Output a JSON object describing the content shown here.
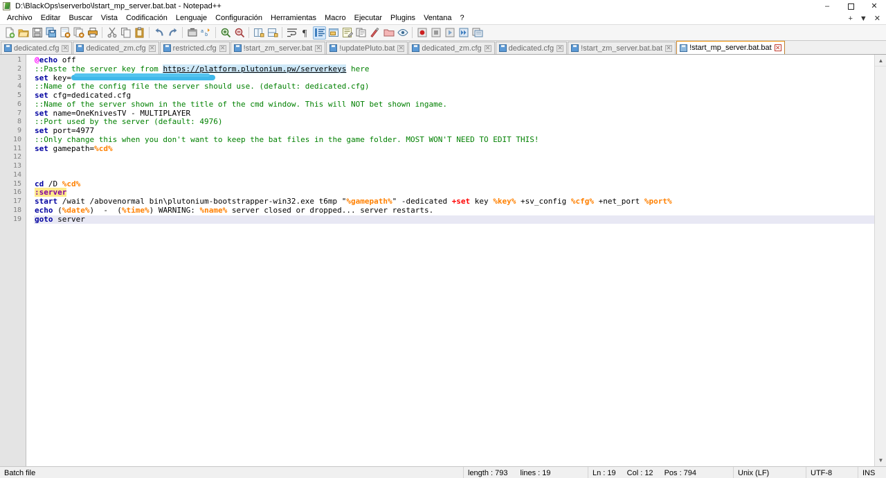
{
  "window": {
    "title": "D:\\BlackOps\\serverbo\\lstart_mp_server.bat.bat - Notepad++",
    "icon": "notepad-plus-plus-icon",
    "controls": {
      "minimize": "–",
      "maximize": "❐",
      "close": "✕"
    }
  },
  "menubar": {
    "items": [
      "Archivo",
      "Editar",
      "Buscar",
      "Vista",
      "Codificación",
      "Lenguaje",
      "Configuración",
      "Herramientas",
      "Macro",
      "Ejecutar",
      "Plugins",
      "Ventana",
      "?"
    ],
    "right": {
      "plus": "+",
      "chevron": "▼",
      "close": "✕"
    }
  },
  "toolbar": {
    "items": [
      "new-file-icon",
      "open-file-icon",
      "save-icon",
      "save-all-icon",
      "close-file-icon",
      "close-all-icon",
      "print-icon",
      "cut-icon",
      "copy-icon",
      "paste-icon",
      "undo-icon",
      "redo-icon",
      "find-icon",
      "replace-icon",
      "zoom-in-icon",
      "zoom-out-icon",
      "sync-vertical-icon",
      "sync-horizontal-icon",
      "word-wrap-icon",
      "show-all-chars-icon",
      "indent-guide-icon",
      "show-ui-icon",
      "user-define-dialog-icon",
      "document-map-icon",
      "function-list-icon",
      "folder-as-workspace-icon",
      "monitoring-icon",
      "macro-record-icon",
      "macro-stop-icon",
      "macro-playback-icon",
      "macro-run-multiple-icon",
      "macro-save-icon"
    ]
  },
  "tabs": [
    {
      "label": "dedicated.cfg",
      "active": false
    },
    {
      "label": "dedicated_zm.cfg",
      "active": false
    },
    {
      "label": "restricted.cfg",
      "active": false
    },
    {
      "label": "!start_zm_server.bat",
      "active": false
    },
    {
      "label": "!updatePluto.bat",
      "active": false
    },
    {
      "label": "dedicated_zm.cfg",
      "active": false
    },
    {
      "label": "dedicated.cfg",
      "active": false
    },
    {
      "label": "!start_zm_server.bat.bat",
      "active": false
    },
    {
      "label": "!start_mp_server.bat.bat",
      "active": true
    }
  ],
  "editor": {
    "line_numbers": [
      1,
      2,
      3,
      4,
      5,
      6,
      7,
      8,
      9,
      10,
      11,
      12,
      13,
      14,
      15,
      16,
      17,
      18,
      19
    ],
    "current_line": 19,
    "lines": [
      {
        "n": 1,
        "tokens": [
          {
            "t": "@",
            "c": "c-at"
          },
          {
            "t": "echo",
            "c": "c-cmd"
          },
          {
            "t": " off",
            "c": "c-plain"
          }
        ]
      },
      {
        "n": 2,
        "tokens": [
          {
            "t": "::Paste the server key from ",
            "c": "c-comment"
          },
          {
            "t": "https://platform.plutonium.pw/serverkeys",
            "c": "c-url"
          },
          {
            "t": " here",
            "c": "c-comment"
          }
        ]
      },
      {
        "n": 3,
        "tokens": [
          {
            "t": "set",
            "c": "c-cmd"
          },
          {
            "t": " key=",
            "c": "c-plain"
          },
          {
            "t": "",
            "c": "redact-block"
          }
        ]
      },
      {
        "n": 4,
        "tokens": [
          {
            "t": "::Name of the config file the server should use. (default: dedicated.cfg)",
            "c": "c-comment"
          }
        ]
      },
      {
        "n": 5,
        "tokens": [
          {
            "t": "set",
            "c": "c-cmd"
          },
          {
            "t": " cfg=dedicated.cfg",
            "c": "c-plain"
          }
        ]
      },
      {
        "n": 6,
        "tokens": [
          {
            "t": "::Name of the server shown in the title of the cmd window. This will NOT bet shown ingame.",
            "c": "c-comment"
          }
        ]
      },
      {
        "n": 7,
        "tokens": [
          {
            "t": "set",
            "c": "c-cmd"
          },
          {
            "t": " name=OneKnivesTV - MULTIPLAYER",
            "c": "c-plain"
          }
        ]
      },
      {
        "n": 8,
        "tokens": [
          {
            "t": "::Port used by the server (default: 4976)",
            "c": "c-comment"
          }
        ]
      },
      {
        "n": 9,
        "tokens": [
          {
            "t": "set",
            "c": "c-cmd"
          },
          {
            "t": " port=4977",
            "c": "c-plain"
          }
        ]
      },
      {
        "n": 10,
        "tokens": [
          {
            "t": "::Only change this when you don't want to keep the bat files in the game folder. MOST WON'T NEED TO EDIT THIS!",
            "c": "c-comment"
          }
        ]
      },
      {
        "n": 11,
        "tokens": [
          {
            "t": "set",
            "c": "c-cmd"
          },
          {
            "t": " gamepath=",
            "c": "c-plain"
          },
          {
            "t": "%cd%",
            "c": "c-var"
          }
        ]
      },
      {
        "n": 12,
        "tokens": [
          {
            "t": "",
            "c": "c-plain"
          }
        ]
      },
      {
        "n": 13,
        "tokens": [
          {
            "t": "",
            "c": "c-plain"
          }
        ]
      },
      {
        "n": 14,
        "tokens": [
          {
            "t": "",
            "c": "c-plain"
          }
        ]
      },
      {
        "n": 15,
        "tokens": [
          {
            "t": "cd",
            "c": "c-cmd"
          },
          {
            "t": " /D ",
            "c": "c-plain"
          },
          {
            "t": "%cd%",
            "c": "c-var"
          }
        ]
      },
      {
        "n": 16,
        "tokens": [
          {
            "t": ":server",
            "c": "c-label"
          }
        ]
      },
      {
        "n": 17,
        "tokens": [
          {
            "t": "start",
            "c": "c-cmd"
          },
          {
            "t": " /wait /abovenormal bin\\plutonium-bootstrapper-win32.exe t6mp \"",
            "c": "c-plain"
          },
          {
            "t": "%gamepath%",
            "c": "c-var"
          },
          {
            "t": "\" -dedicated ",
            "c": "c-plain"
          },
          {
            "t": "+set",
            "c": "c-opt"
          },
          {
            "t": " key ",
            "c": "c-plain"
          },
          {
            "t": "%key%",
            "c": "c-var"
          },
          {
            "t": " +sv_config ",
            "c": "c-plain"
          },
          {
            "t": "%cfg%",
            "c": "c-var"
          },
          {
            "t": " +net_port ",
            "c": "c-plain"
          },
          {
            "t": "%port%",
            "c": "c-var"
          }
        ]
      },
      {
        "n": 18,
        "tokens": [
          {
            "t": "echo",
            "c": "c-cmd"
          },
          {
            "t": " (",
            "c": "c-plain"
          },
          {
            "t": "%date%",
            "c": "c-var"
          },
          {
            "t": ")  -  (",
            "c": "c-plain"
          },
          {
            "t": "%time%",
            "c": "c-var"
          },
          {
            "t": ") WARNING: ",
            "c": "c-plain"
          },
          {
            "t": "%name%",
            "c": "c-var"
          },
          {
            "t": " server closed or dropped... server restarts.",
            "c": "c-plain"
          }
        ]
      },
      {
        "n": 19,
        "tokens": [
          {
            "t": "goto",
            "c": "c-cmd"
          },
          {
            "t": " server",
            "c": "c-plain"
          }
        ]
      }
    ]
  },
  "statusbar": {
    "doctype": "Batch file",
    "length_label": "length : 793",
    "lines_label": "lines : 19",
    "ln": "Ln : 19",
    "col": "Col : 12",
    "pos": "Pos : 794",
    "eol": "Unix (LF)",
    "encoding": "UTF-8",
    "insert_mode": "INS"
  },
  "colors": {
    "active_tab_accent": "#f09000",
    "keyword": "#0000a0",
    "comment": "#008000",
    "variable": "#ff8000",
    "option": "#ff0000",
    "label_bg": "#ffea8a",
    "redaction": "#3fb8ea",
    "current_line_bg": "#e8e8f4"
  }
}
